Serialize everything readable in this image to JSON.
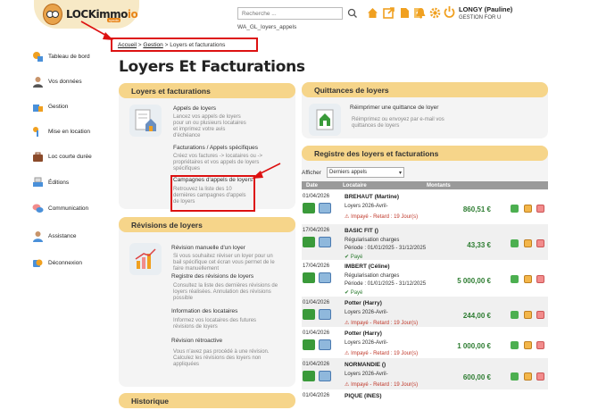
{
  "app": {
    "logo_text": "LOCKimmo",
    "logo_suffix": "io",
    "logo_tag": "syndic"
  },
  "header": {
    "search_placeholder": "Recherche ...",
    "page_code": "WA_GL_loyers_appels",
    "user_name": "LONGY (Pauline)",
    "user_role": "GESTION FOR U",
    "icons": [
      "home-icon",
      "external-link-icon",
      "document-icon",
      "document-upload-icon",
      "bell-icon",
      "gear-icon",
      "power-icon"
    ]
  },
  "breadcrumb": {
    "home": "Accueil",
    "section": "Gestion",
    "current": "Loyers et facturations",
    "sep": ">"
  },
  "sidebar": {
    "items": [
      {
        "label": "Tableau de bord",
        "icon": "dashboard-icon"
      },
      {
        "label": "Vos données",
        "icon": "user-icon"
      },
      {
        "label": "Gestion",
        "icon": "building-icon"
      },
      {
        "label": "Mise en location",
        "icon": "key-icon"
      },
      {
        "label": "Loc courte durée",
        "icon": "suitcase-icon"
      },
      {
        "label": "Éditions",
        "icon": "print-icon"
      },
      {
        "label": "Communication",
        "icon": "chat-icon"
      },
      {
        "label": "Assistance",
        "icon": "support-icon"
      },
      {
        "label": "Déconnexion",
        "icon": "logout-icon"
      }
    ]
  },
  "main": {
    "title": "Loyers Et Facturations"
  },
  "loyers_panel": {
    "title": "Loyers et facturations",
    "appels_title": "Appels de loyers",
    "appels_desc": [
      "Lancez vos appels de loyers",
      "pour un ou plusieurs locataires",
      "et imprimez votre avis",
      "d'échéance"
    ],
    "factu_title": "Facturations / Appels spécifiques",
    "factu_desc": [
      "Créez vos factures -> locataires ou ->",
      "propriétaires et vos appels de loyers",
      "spécifiques"
    ],
    "camp_title": "Campagnes d'appels de loyers",
    "camp_desc": [
      "Retrouvez la liste des 10",
      "dernières campagnes d'appels",
      "de loyers"
    ]
  },
  "revisions_panel": {
    "title": "Révisions de loyers",
    "manual_title": "Révision manuelle d'un loyer",
    "manual_desc": [
      "Si vous souhaitez réviser un loyer pour un",
      "bail spécifique cet écran vous permet de le",
      "faire manuellement"
    ],
    "reg_title": "Registre des révisions de loyers",
    "reg_desc": [
      "Consultez la liste des dernières révisions de",
      "loyers réalisées. Annulation des révisions",
      "possible"
    ],
    "info_title": "Information des locataires",
    "info_desc": [
      "Informez vos locataires des futures",
      "révisions de loyers"
    ],
    "retro_title": "Révision rétroactive",
    "retro_desc": [
      "Vous n'avez pas procédé à une révision.",
      "Calculez les révisions des loyers non",
      "appliquées"
    ]
  },
  "historique_panel": {
    "title": "Historique"
  },
  "quittances_panel": {
    "title": "Quittances de loyers",
    "item_title": "Réimprimer une quittance de loyer",
    "item_desc": [
      "Réimprimez ou envoyez par e-mail vos",
      "quittances de loyers"
    ]
  },
  "registre": {
    "title": "Registre des loyers et facturations",
    "show_label": "Afficher",
    "select_value": "Derniers appels",
    "columns": {
      "date": "Date",
      "tenant": "Locataire",
      "amount": "Montants"
    },
    "rows": [
      {
        "date": "01/04/2026",
        "tenant": "BREHAUT (Martine)",
        "line2": "Loyers 2026-Avril-",
        "line3": "",
        "status": "Impayé - Retard : 19 Jour(s)",
        "paid": false,
        "amount": "860,51 €"
      },
      {
        "date": "17/04/2026",
        "tenant": "BASIC FIT ()",
        "line2": "Régularisation charges",
        "line3": "Période : 01/01/2025 - 31/12/2025",
        "status": "Payé",
        "paid": true,
        "amount": "43,33 €"
      },
      {
        "date": "17/04/2026",
        "tenant": "IMBERT (Céline)",
        "line2": "Régularisation charges",
        "line3": "Période : 01/01/2025 - 31/12/2025",
        "status": "Payé",
        "paid": true,
        "amount": "5 000,00 €"
      },
      {
        "date": "01/04/2026",
        "tenant": "Potter (Harry)",
        "line2": "Loyers 2026-Avril-",
        "line3": "",
        "status": "Impayé - Retard : 19 Jour(s)",
        "paid": false,
        "amount": "244,00 €"
      },
      {
        "date": "01/04/2026",
        "tenant": "Potter (Harry)",
        "line2": "Loyers 2026-Avril-",
        "line3": "",
        "status": "Impayé - Retard : 19 Jour(s)",
        "paid": false,
        "amount": "1 000,00 €"
      },
      {
        "date": "01/04/2026",
        "tenant": "NORMANDIE ()",
        "line2": "Loyers 2026-Avril-",
        "line3": "",
        "status": "Impayé - Retard : 19 Jour(s)",
        "paid": false,
        "amount": "600,00 €"
      },
      {
        "date": "01/04/2026",
        "tenant": "PIQUE (INES)",
        "line2": "",
        "line3": "",
        "status": "",
        "paid": false,
        "amount": ""
      }
    ]
  },
  "colors": {
    "accent": "#f6d58a",
    "annotation": "#dd1111",
    "amount": "#2e7d32",
    "overdue": "#c0392b"
  }
}
